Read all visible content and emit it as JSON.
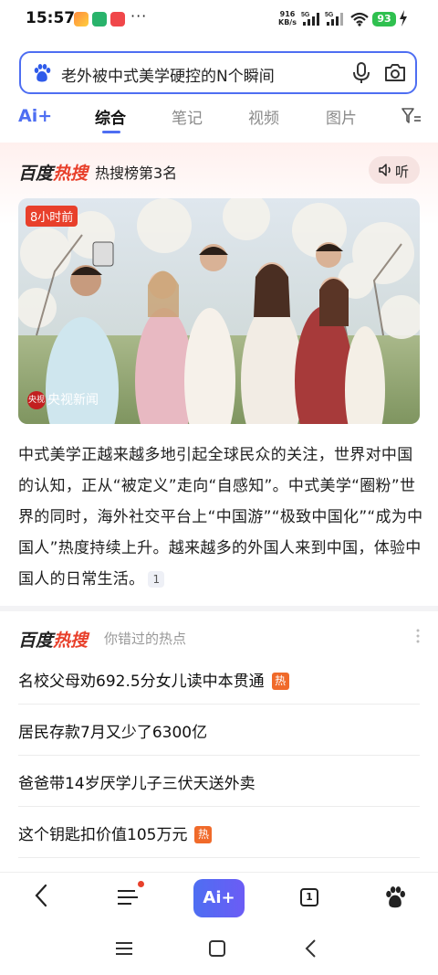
{
  "status_bar": {
    "time": "15:57",
    "network_speed_value": "916",
    "network_speed_unit": "KB/s",
    "signal1_label": "5G",
    "signal2_label": "5G",
    "battery": "93",
    "more": "···"
  },
  "search": {
    "query": "老外被中式美学硬控的N个瞬间",
    "icons": [
      "baidu-paw-icon",
      "microphone-icon",
      "camera-icon"
    ]
  },
  "tabs": {
    "ai_label": "Ai+",
    "items": [
      {
        "label": "综合",
        "active": true
      },
      {
        "label": "笔记",
        "active": false
      },
      {
        "label": "视频",
        "active": false
      },
      {
        "label": "图片",
        "active": false
      }
    ]
  },
  "hot_card": {
    "logo_part1": "百度",
    "logo_part2": "热搜",
    "rank_text": "热搜榜第3名",
    "listen_label": "听",
    "time_badge": "8小时前",
    "source_logo": "央视",
    "source_name": "央视新闻",
    "summary": "中式美学正越来越多地引起全球民众的关注，世界对中国的认知，正从“被定义”走向“自感知”。中式美学“圈粉”世界的同时，海外社交平台上“中国游”“极致中国化”“成为中国人”热度持续上升。越来越多的外国人来到中国，体验中国人的日常生活。",
    "citation": "1"
  },
  "missed_section": {
    "logo_part1": "百度",
    "logo_part2": "热搜",
    "title": "你错过的热点",
    "hot_label": "热",
    "items": [
      {
        "text": "名校父母劝692.5分女儿读中本贯通",
        "hot": true
      },
      {
        "text": "居民存款7月又少了6300亿",
        "hot": false
      },
      {
        "text": "爸爸带14岁厌学儿子三伏天送外卖",
        "hot": false
      },
      {
        "text": "这个钥匙扣价值105万元",
        "hot": true
      }
    ]
  },
  "bottom_nav": {
    "ai_label": "Ai+",
    "tab_count": "1"
  },
  "colors": {
    "accent": "#4e6ef2",
    "hot_red": "#e8402b",
    "hot_tag": "#f06a2a",
    "battery": "#2fc04f"
  }
}
